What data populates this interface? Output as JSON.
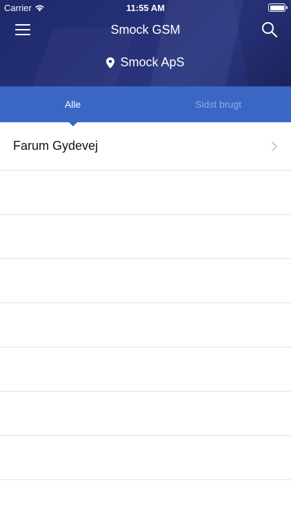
{
  "status_bar": {
    "carrier": "Carrier",
    "time": "11:55 AM"
  },
  "nav": {
    "title": "Smock GSM",
    "menu_icon": "hamburger-menu-icon",
    "search_icon": "search-icon"
  },
  "location": {
    "label": "Smock ApS",
    "icon": "map-pin-icon"
  },
  "tabs": [
    {
      "label": "Alle",
      "active": true
    },
    {
      "label": "Sidst brugt",
      "active": false
    }
  ],
  "list": {
    "items": [
      {
        "label": "Farum Gydevej"
      }
    ]
  },
  "colors": {
    "header": "#252f75",
    "tab_bar": "#3a66c4",
    "tab_inactive_text": "#8fb0ec",
    "divider": "#e3e3e3"
  }
}
